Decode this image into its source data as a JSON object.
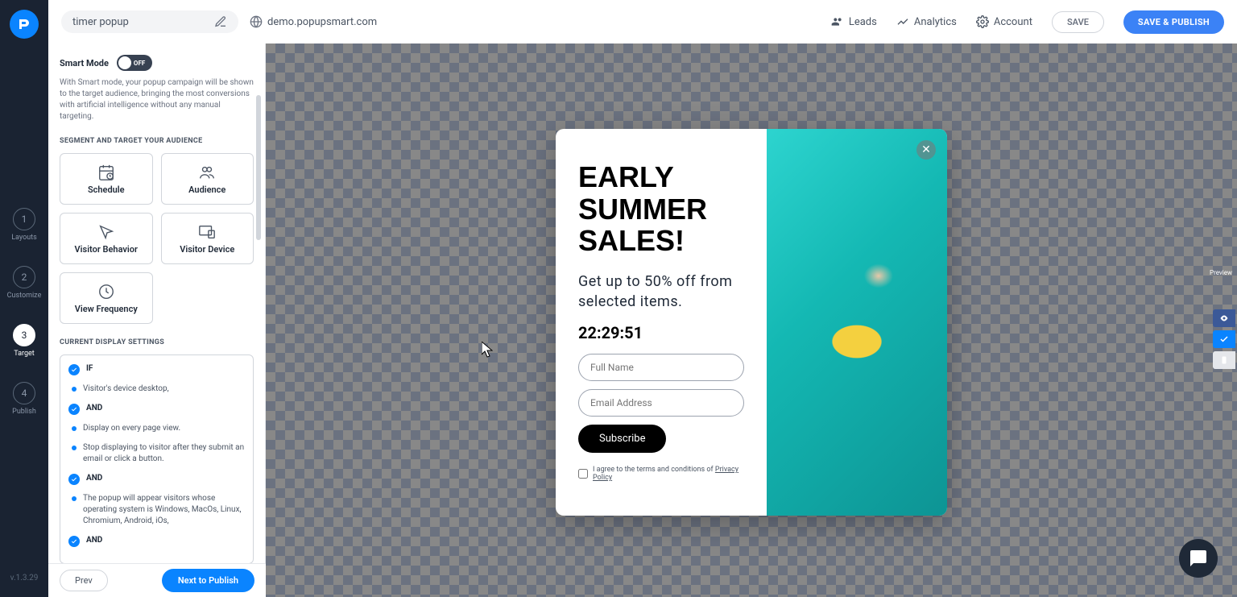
{
  "app": {
    "title": "timer popup",
    "domain": "demo.popupsmart.com",
    "version": "v.1.3.29"
  },
  "topnav": {
    "leads": "Leads",
    "analytics": "Analytics",
    "account": "Account",
    "save": "SAVE",
    "publish": "SAVE & PUBLISH"
  },
  "steps": [
    {
      "num": "1",
      "label": "Layouts"
    },
    {
      "num": "2",
      "label": "Customize"
    },
    {
      "num": "3",
      "label": "Target"
    },
    {
      "num": "4",
      "label": "Publish"
    }
  ],
  "panel": {
    "smart_label": "Smart Mode",
    "smart_state": "OFF",
    "smart_desc": "With Smart mode, your popup campaign will be shown to the target audience, bringing the most conversions with artificial intelligence without any manual targeting.",
    "seg_header": "SEGMENT AND TARGET YOUR AUDIENCE",
    "cards": {
      "schedule": "Schedule",
      "audience": "Audience",
      "behavior": "Visitor Behavior",
      "device": "Visitor Device",
      "frequency": "View Frequency"
    },
    "rules_header": "CURRENT DISPLAY SETTINGS",
    "rules": {
      "if": "IF",
      "r1": "Visitor's device desktop,",
      "and1": "AND",
      "r2": "Display on every page view.",
      "r3": "Stop displaying to visitor after they submit an email or click a button.",
      "and2": "AND",
      "r4": "The popup will appear visitors whose operating system is Windows, MacOs, Linux, Chromium, Android, iOs,",
      "and3": "AND"
    },
    "prev": "Prev",
    "next": "Next to Publish"
  },
  "popup": {
    "title": "EARLY SUMMER SALES!",
    "sub": "Get up to 50% off from selected items.",
    "timer": "22:29:51",
    "name_ph": "Full Name",
    "email_ph": "Email Address",
    "button": "Subscribe",
    "agree_pre": "I agree to the terms and conditions of ",
    "agree_link": "Privacy Policy"
  },
  "preview_label": "Preview"
}
